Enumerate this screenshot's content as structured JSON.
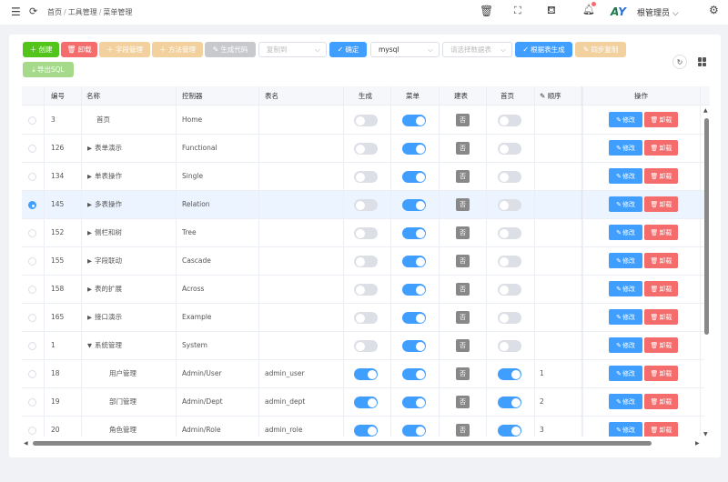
{
  "breadcrumb": [
    "首页",
    "工具管理",
    "菜单管理"
  ],
  "user": {
    "name": "根管理员"
  },
  "toolbar": {
    "create": "创建",
    "unload": "卸载",
    "field_mgmt": "字段管理",
    "method_mgmt": "方法管理",
    "gen_code": "生成代码",
    "copy_to_placeholder": "复制到",
    "confirm": "确定",
    "db_value": "mysql",
    "table_placeholder": "请选择数据表",
    "gen_from_table": "根据表生成",
    "sync_copy": "同步复制",
    "export_sql": "导出SQL"
  },
  "columns": {
    "id": "编号",
    "name": "名称",
    "controller": "控制器",
    "table": "表名",
    "generate": "生成",
    "menu": "菜单",
    "build_table": "建表",
    "home": "首页",
    "order": "顺序",
    "actions": "操作"
  },
  "actions": {
    "edit": "修改",
    "unload": "卸载"
  },
  "tag_no": "否",
  "rows": [
    {
      "id": "3",
      "name": "首页",
      "controller": "Home",
      "table": "",
      "gen": false,
      "menu": true,
      "home": false,
      "order": "",
      "tree": "none",
      "indent": 0,
      "selected": false
    },
    {
      "id": "126",
      "name": "表单演示",
      "controller": "Functional",
      "table": "",
      "gen": false,
      "menu": true,
      "home": false,
      "order": "",
      "tree": "collapsed",
      "indent": 0,
      "selected": false
    },
    {
      "id": "134",
      "name": "单表操作",
      "controller": "Single",
      "table": "",
      "gen": false,
      "menu": true,
      "home": false,
      "order": "",
      "tree": "collapsed",
      "indent": 0,
      "selected": false
    },
    {
      "id": "145",
      "name": "多表操作",
      "controller": "Relation",
      "table": "",
      "gen": false,
      "menu": true,
      "home": false,
      "order": "",
      "tree": "collapsed",
      "indent": 0,
      "selected": true
    },
    {
      "id": "152",
      "name": "侧栏和树",
      "controller": "Tree",
      "table": "",
      "gen": false,
      "menu": true,
      "home": false,
      "order": "",
      "tree": "collapsed",
      "indent": 0,
      "selected": false
    },
    {
      "id": "155",
      "name": "字段联动",
      "controller": "Cascade",
      "table": "",
      "gen": false,
      "menu": true,
      "home": false,
      "order": "",
      "tree": "collapsed",
      "indent": 0,
      "selected": false
    },
    {
      "id": "158",
      "name": "表的扩展",
      "controller": "Across",
      "table": "",
      "gen": false,
      "menu": true,
      "home": false,
      "order": "",
      "tree": "collapsed",
      "indent": 0,
      "selected": false
    },
    {
      "id": "165",
      "name": "接口演示",
      "controller": "Example",
      "table": "",
      "gen": false,
      "menu": true,
      "home": false,
      "order": "",
      "tree": "collapsed",
      "indent": 0,
      "selected": false
    },
    {
      "id": "1",
      "name": "系统管理",
      "controller": "System",
      "table": "",
      "gen": false,
      "menu": true,
      "home": false,
      "order": "",
      "tree": "expanded",
      "indent": 0,
      "selected": false
    },
    {
      "id": "18",
      "name": "用户管理",
      "controller": "Admin/User",
      "table": "admin_user",
      "gen": true,
      "menu": true,
      "home": true,
      "order": "1",
      "tree": "none",
      "indent": 1,
      "selected": false
    },
    {
      "id": "19",
      "name": "部门管理",
      "controller": "Admin/Dept",
      "table": "admin_dept",
      "gen": true,
      "menu": true,
      "home": true,
      "order": "2",
      "tree": "none",
      "indent": 1,
      "selected": false
    },
    {
      "id": "20",
      "name": "角色管理",
      "controller": "Admin/Role",
      "table": "admin_role",
      "gen": true,
      "menu": true,
      "home": true,
      "order": "3",
      "tree": "none",
      "indent": 1,
      "selected": false
    }
  ]
}
